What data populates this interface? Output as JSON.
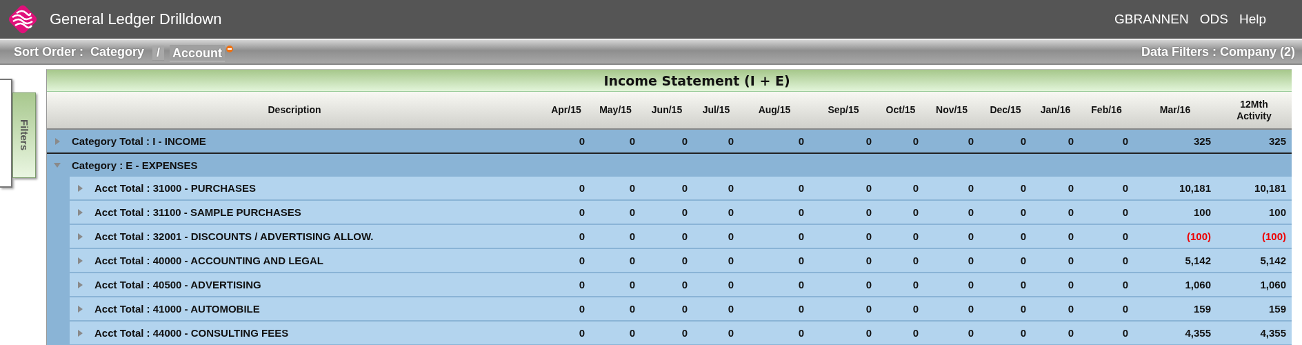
{
  "app_bar": {
    "title": "General Ledger Drilldown",
    "links": [
      "GBRANNEN",
      "ODS",
      "Help"
    ]
  },
  "sort_bar": {
    "label": "Sort Order :",
    "items": [
      {
        "label": "Category",
        "kind": "plain"
      },
      {
        "label": "/",
        "kind": "separator"
      },
      {
        "label": "Account",
        "kind": "link",
        "removable": true
      }
    ],
    "data_filters": "Data Filters : Company (2)"
  },
  "filters_tab": {
    "label": "Filters"
  },
  "table": {
    "title": "Income Statement (I + E)",
    "columns": [
      "Description",
      "Apr/15",
      "May/15",
      "Jun/15",
      "Jul/15",
      "Aug/15",
      "Sep/15",
      "Oct/15",
      "Nov/15",
      "Dec/15",
      "Jan/16",
      "Feb/16",
      "Mar/16",
      "12Mth Activity"
    ],
    "rows": [
      {
        "kind": "category_total",
        "expanded": false,
        "label": "Category Total : I - INCOME",
        "values": [
          "0",
          "0",
          "0",
          "0",
          "0",
          "0",
          "0",
          "0",
          "0",
          "0",
          "0",
          "325",
          "325"
        ]
      },
      {
        "kind": "category",
        "expanded": true,
        "label": "Category : E - EXPENSES"
      },
      {
        "kind": "account",
        "expanded": false,
        "label": "Acct Total : 31000 - PURCHASES",
        "values": [
          "0",
          "0",
          "0",
          "0",
          "0",
          "0",
          "0",
          "0",
          "0",
          "0",
          "0",
          "10,181",
          "10,181"
        ]
      },
      {
        "kind": "account",
        "expanded": false,
        "label": "Acct Total : 31100 - SAMPLE PURCHASES",
        "values": [
          "0",
          "0",
          "0",
          "0",
          "0",
          "0",
          "0",
          "0",
          "0",
          "0",
          "0",
          "100",
          "100"
        ]
      },
      {
        "kind": "account",
        "expanded": false,
        "label": "Acct Total : 32001 - DISCOUNTS / ADVERTISING ALLOW.",
        "values": [
          "0",
          "0",
          "0",
          "0",
          "0",
          "0",
          "0",
          "0",
          "0",
          "0",
          "0",
          "(100)",
          "(100)"
        ],
        "negative": [
          false,
          false,
          false,
          false,
          false,
          false,
          false,
          false,
          false,
          false,
          false,
          true,
          true
        ]
      },
      {
        "kind": "account",
        "expanded": false,
        "label": "Acct Total : 40000 - ACCOUNTING AND LEGAL",
        "values": [
          "0",
          "0",
          "0",
          "0",
          "0",
          "0",
          "0",
          "0",
          "0",
          "0",
          "0",
          "5,142",
          "5,142"
        ]
      },
      {
        "kind": "account",
        "expanded": false,
        "label": "Acct Total : 40500 - ADVERTISING",
        "values": [
          "0",
          "0",
          "0",
          "0",
          "0",
          "0",
          "0",
          "0",
          "0",
          "0",
          "0",
          "1,060",
          "1,060"
        ]
      },
      {
        "kind": "account",
        "expanded": false,
        "label": "Acct Total : 41000 - AUTOMOBILE",
        "values": [
          "0",
          "0",
          "0",
          "0",
          "0",
          "0",
          "0",
          "0",
          "0",
          "0",
          "0",
          "159",
          "159"
        ]
      },
      {
        "kind": "account",
        "expanded": false,
        "label": "Acct Total : 44000 - CONSULTING FEES",
        "values": [
          "0",
          "0",
          "0",
          "0",
          "0",
          "0",
          "0",
          "0",
          "0",
          "0",
          "0",
          "4,355",
          "4,355"
        ]
      }
    ]
  }
}
